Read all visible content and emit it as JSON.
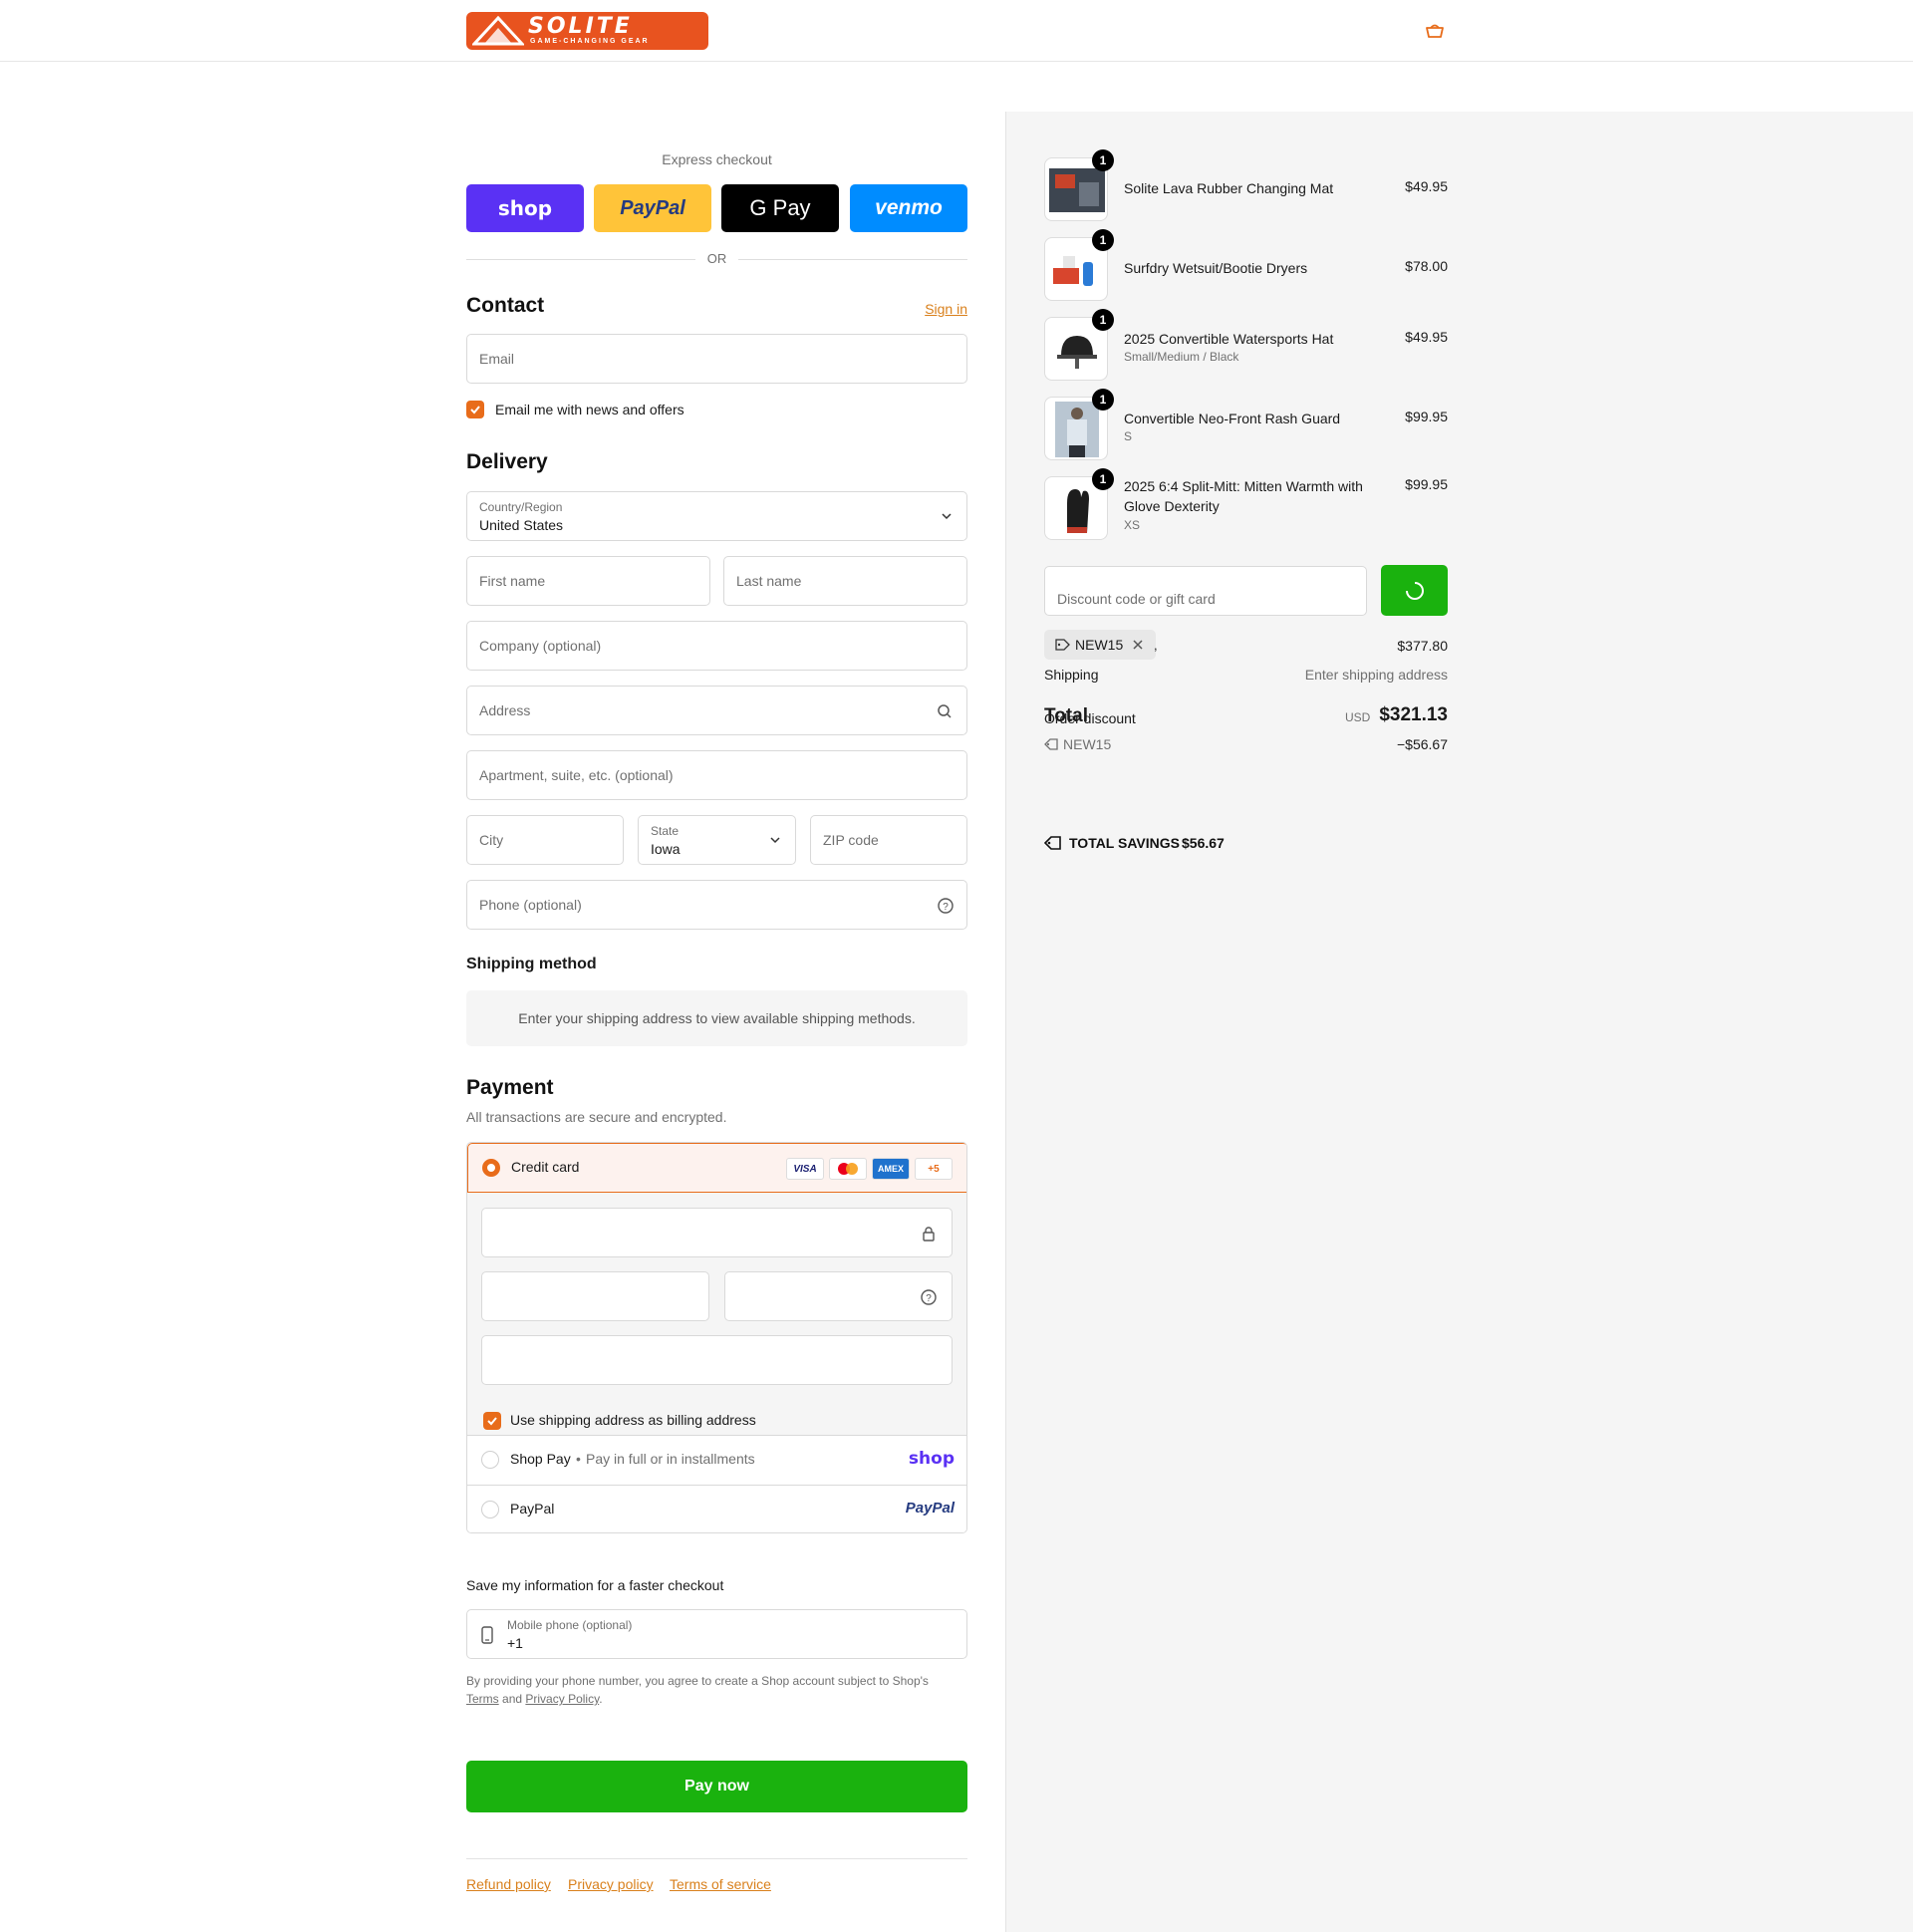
{
  "brand": {
    "name": "SOLITE",
    "tagline": "GAME-CHANGING GEAR",
    "accent": "#e86c1a",
    "green": "#1ab20e"
  },
  "express": {
    "title": "Express checkout",
    "buttons": [
      {
        "label": "shop",
        "color": "#5a31f4"
      },
      {
        "label": "PayPal",
        "color": "#ffc439"
      },
      {
        "label": "G Pay",
        "color": "#000000"
      },
      {
        "label": "venmo",
        "color": "#008cff"
      }
    ],
    "or": "OR"
  },
  "contact": {
    "heading": "Contact",
    "signin": "Sign in",
    "email_placeholder": "Email",
    "newsletter_label": "Email me with news and offers"
  },
  "delivery": {
    "heading": "Delivery",
    "country_label": "Country/Region",
    "country_value": "United States",
    "first_name": "First name",
    "last_name": "Last name",
    "company": "Company (optional)",
    "address": "Address",
    "apartment": "Apartment, suite, etc. (optional)",
    "city": "City",
    "state_label": "State",
    "state_value": "Iowa",
    "zip": "ZIP code",
    "phone": "Phone (optional)"
  },
  "shipping_method": {
    "heading": "Shipping method",
    "message": "Enter your shipping address to view available shipping methods."
  },
  "payment": {
    "heading": "Payment",
    "subtitle": "All transactions are secure and encrypted.",
    "credit_card_label": "Credit card",
    "card_icons": [
      "VISA",
      "MC",
      "AMEX",
      "+5"
    ],
    "billing_label": "Use shipping address as billing address",
    "shoppay_label": "Shop Pay",
    "shoppay_sub": "Pay in full or in installments",
    "shoppay_logo": "shop",
    "paypal_label": "PayPal",
    "paypal_logo": "PayPal"
  },
  "save_info": {
    "heading": "Save my information for a faster checkout",
    "mobile_label": "Mobile phone (optional)",
    "mobile_value": "+1",
    "legal_prefix": "By providing your phone number, you agree to create a Shop account subject to Shop's",
    "terms": "Terms",
    "and": "and",
    "privacy": "Privacy Policy",
    "period": "."
  },
  "pay_now": "Pay now",
  "footer_links": [
    "Refund policy",
    "Privacy policy",
    "Terms of service"
  ],
  "cart": {
    "items": [
      {
        "qty": "1",
        "name": "Solite Lava Rubber Changing Mat",
        "variant": "",
        "price": "$49.95"
      },
      {
        "qty": "1",
        "name": "Surfdry Wetsuit/Bootie Dryers",
        "variant": "",
        "price": "$78.00"
      },
      {
        "qty": "1",
        "name": "2025 Convertible Watersports Hat",
        "variant": "Small/Medium / Black",
        "price": "$49.95"
      },
      {
        "qty": "1",
        "name": "Convertible Neo-Front Rash Guard",
        "variant": "S",
        "price": "$99.95"
      },
      {
        "qty": "1",
        "name": "2025 6:4 Split-Mitt: Mitten Warmth with Glove Dexterity",
        "variant": "XS",
        "price": "$99.95"
      }
    ],
    "discount_placeholder": "Discount code or gift card",
    "applied_code": "NEW15",
    "subtotal_tail": ",",
    "subtotal": "$377.80",
    "shipping_label": "Shipping",
    "shipping_value": "Enter shipping address",
    "total_label": "Total",
    "order_discount_label": "Order discount",
    "currency": "USD",
    "total": "$321.13",
    "discount_code": "NEW15",
    "discount_amount": "−$56.67",
    "savings_label": "TOTAL SAVINGS",
    "savings_value": "$56.67"
  }
}
